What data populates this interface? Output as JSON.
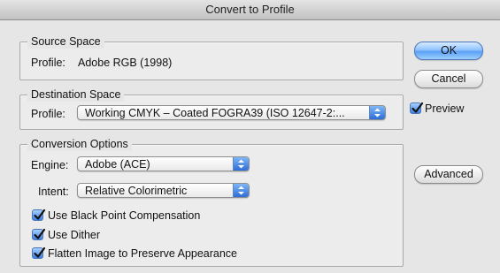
{
  "window": {
    "title": "Convert to Profile"
  },
  "source": {
    "legend": "Source Space",
    "profile_label": "Profile:",
    "profile_value": "Adobe RGB (1998)"
  },
  "destination": {
    "legend": "Destination Space",
    "profile_label": "Profile:",
    "profile_value": "Working CMYK – Coated FOGRA39 (ISO 12647-2:..."
  },
  "conversion": {
    "legend": "Conversion Options",
    "engine_label": "Engine:",
    "engine_value": "Adobe (ACE)",
    "intent_label": "Intent:",
    "intent_value": "Relative Colorimetric",
    "checkboxes": [
      {
        "label": "Use Black Point Compensation",
        "checked": true
      },
      {
        "label": "Use Dither",
        "checked": true
      },
      {
        "label": "Flatten Image to Preserve Appearance",
        "checked": true
      }
    ]
  },
  "buttons": {
    "ok": "OK",
    "cancel": "Cancel",
    "advanced": "Advanced"
  },
  "preview": {
    "label": "Preview",
    "checked": true
  },
  "colors": {
    "accent": "#3c7fe3"
  }
}
